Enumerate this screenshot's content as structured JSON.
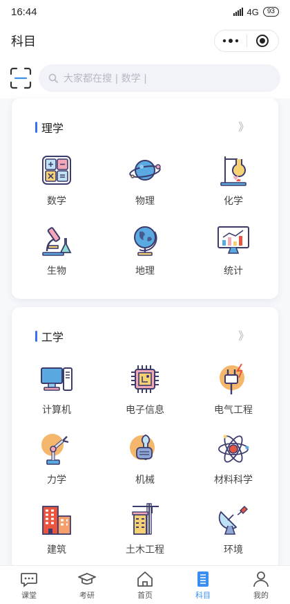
{
  "status": {
    "time": "16:44",
    "network": "4G",
    "battery": "93"
  },
  "header": {
    "title": "科目"
  },
  "search": {
    "placeholder": "大家都在搜 | 数学 |"
  },
  "sections": [
    {
      "title": "理学",
      "more": "》",
      "items": [
        {
          "label": "数学",
          "icon": "calculator-icon"
        },
        {
          "label": "物理",
          "icon": "planet-icon"
        },
        {
          "label": "化学",
          "icon": "flask-stand-icon"
        },
        {
          "label": "生物",
          "icon": "microscope-icon"
        },
        {
          "label": "地理",
          "icon": "globe-icon"
        },
        {
          "label": "统计",
          "icon": "monitor-chart-icon"
        }
      ]
    },
    {
      "title": "工学",
      "more": "》",
      "items": [
        {
          "label": "计算机",
          "icon": "computer-icon"
        },
        {
          "label": "电子信息",
          "icon": "chip-icon"
        },
        {
          "label": "电气工程",
          "icon": "plug-icon"
        },
        {
          "label": "力学",
          "icon": "robot-arm-icon"
        },
        {
          "label": "机械",
          "icon": "wrench-hand-icon"
        },
        {
          "label": "材料科学",
          "icon": "atom-icon"
        },
        {
          "label": "建筑",
          "icon": "buildings-icon"
        },
        {
          "label": "土木工程",
          "icon": "crane-icon"
        },
        {
          "label": "环境",
          "icon": "satellite-dish-icon"
        }
      ]
    }
  ],
  "tabs": [
    {
      "label": "课堂",
      "icon": "chat-icon"
    },
    {
      "label": "考研",
      "icon": "graduation-cap-icon"
    },
    {
      "label": "首页",
      "icon": "home-icon"
    },
    {
      "label": "科目",
      "icon": "book-icon",
      "active": true
    },
    {
      "label": "我的",
      "icon": "user-icon"
    }
  ],
  "colors": {
    "accent": "#3a8ef0",
    "title_bar": "#3a6ff0",
    "icon_fill": "#f5b76c"
  }
}
